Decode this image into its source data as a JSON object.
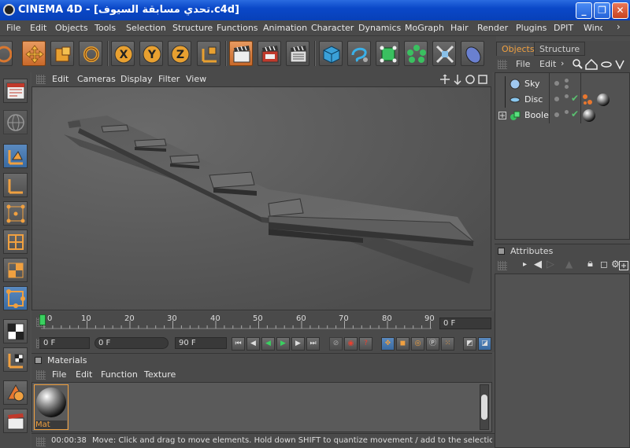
{
  "window": {
    "title": "CINEMA 4D - [تحدي مسابقة السيوف.c4d]",
    "minimize_label": "_",
    "maximize_label": "❐",
    "close_label": "✕"
  },
  "menu": [
    "File",
    "Edit",
    "Objects",
    "Tools",
    "Selection",
    "Structure",
    "Functions",
    "Animation",
    "Character",
    "Dynamics",
    "MoGraph",
    "Hair",
    "Render",
    "Plugins",
    "DPIT",
    "Wind"
  ],
  "viewport": {
    "menu": [
      "Edit",
      "Cameras",
      "Display",
      "Filter",
      "View"
    ]
  },
  "timeline": {
    "ticks": [
      "0",
      "10",
      "20",
      "30",
      "40",
      "50",
      "60",
      "70",
      "80",
      "90"
    ],
    "current_frame_field": "0 F",
    "start_field": "0 F",
    "slider_field": "0 F",
    "end_field": "90 F"
  },
  "materials": {
    "title": "Materials",
    "menu": [
      "File",
      "Edit",
      "Function",
      "Texture"
    ],
    "items": [
      {
        "name": "Mat"
      }
    ]
  },
  "status": {
    "time": "00:00:38",
    "message": "Move: Click and drag to move elements. Hold down SHIFT to quantize movement / add to the selection in p"
  },
  "objects_panel": {
    "tabs": [
      "Objects",
      "Structure"
    ],
    "active_tab": "Objects",
    "menu": [
      "File",
      "Edit"
    ],
    "objects": [
      {
        "name": "Sky",
        "type": "sky-icon"
      },
      {
        "name": "Disc",
        "type": "disc-icon"
      },
      {
        "name": "Boole",
        "type": "boole-icon"
      }
    ]
  },
  "attributes_panel": {
    "title": "Attributes"
  },
  "colors": {
    "accent_orange": "#d9772f",
    "active_tab_text": "#f0a040",
    "titlebar_blue": "#0a48c8"
  }
}
